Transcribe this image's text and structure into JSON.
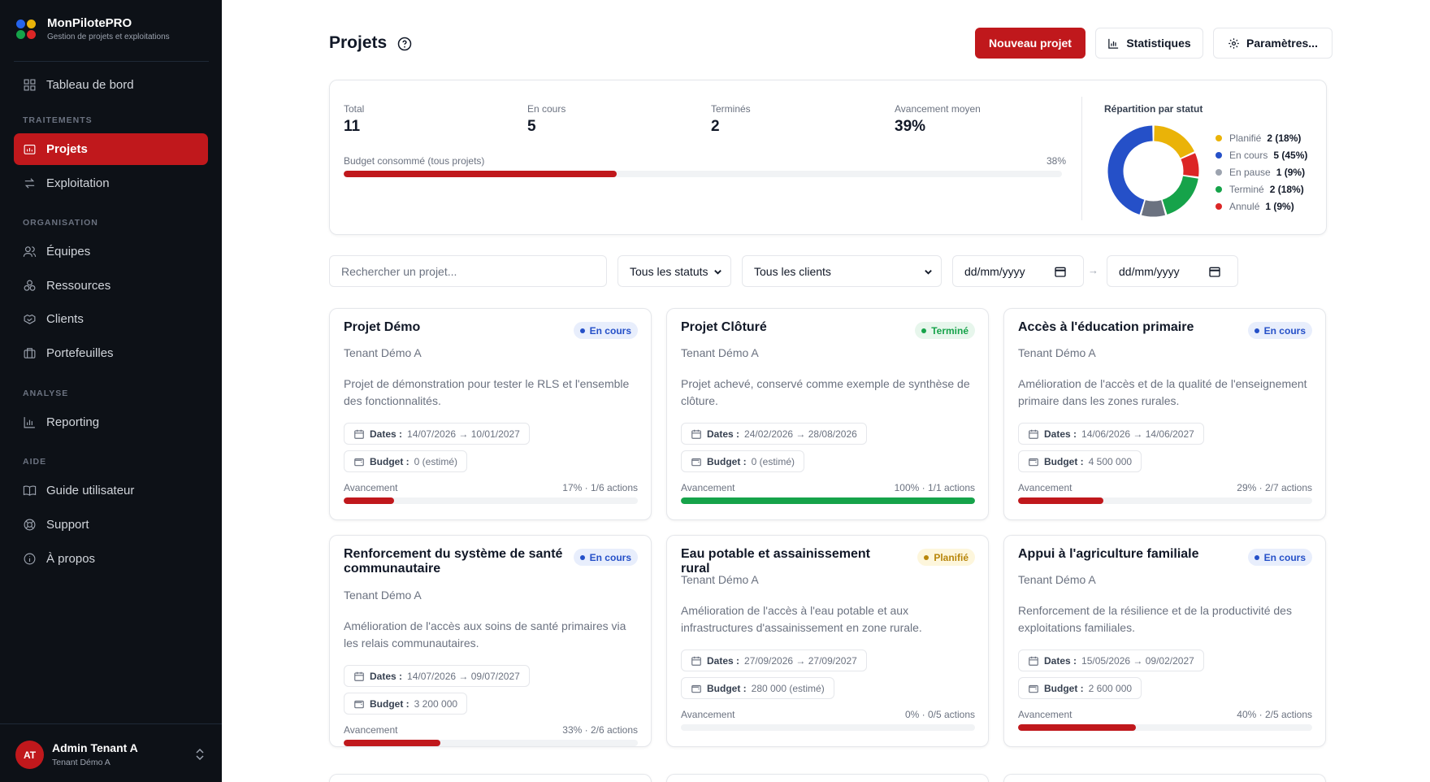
{
  "app": {
    "name": "MonPilotePRO",
    "subtitle": "Gestion de projets et exploitations",
    "logo_colors": [
      "#2563eb",
      "#eab308",
      "#16a34a",
      "#dc2626"
    ]
  },
  "sidebar": {
    "dashboard": "Tableau de bord",
    "sections": {
      "traitements": "TRAITEMENTS",
      "organisation": "ORGANISATION",
      "analyse": "ANALYSE",
      "aide": "AIDE"
    },
    "items": {
      "projets": "Projets",
      "exploitation": "Exploitation",
      "equipes": "Équipes",
      "ressources": "Ressources",
      "clients": "Clients",
      "portefeuilles": "Portefeuilles",
      "reporting": "Reporting",
      "guide": "Guide utilisateur",
      "support": "Support",
      "apropos": "À propos"
    },
    "user": {
      "initials": "AT",
      "name": "Admin Tenant A",
      "tenant": "Tenant Démo A"
    }
  },
  "header": {
    "title": "Projets",
    "buttons": {
      "new": "Nouveau projet",
      "stats": "Statistiques",
      "settings": "Paramètres..."
    }
  },
  "stats": {
    "total_label": "Total",
    "total_value": "11",
    "encours_label": "En cours",
    "encours_value": "5",
    "termines_label": "Terminés",
    "termines_value": "2",
    "avancement_label": "Avancement moyen",
    "avancement_value": "39%",
    "budget_label": "Budget consommé (tous projets)",
    "budget_pct": "38%",
    "budget_fraction": 0.38,
    "repartition_title": "Répartition par statut",
    "repartition": [
      {
        "label": "Planifié",
        "value": "2 (18%)",
        "count": 2,
        "color": "#eab308"
      },
      {
        "label": "En cours",
        "value": "5 (45%)",
        "count": 5,
        "color": "#2550c8"
      },
      {
        "label": "En pause",
        "value": "1 (9%)",
        "count": 1,
        "color": "#9ca3af"
      },
      {
        "label": "Terminé",
        "value": "2 (18%)",
        "count": 2,
        "color": "#16a34a"
      },
      {
        "label": "Annulé",
        "value": "1 (9%)",
        "count": 1,
        "color": "#dc2626"
      }
    ],
    "donut_order": [
      {
        "count": 2,
        "color": "#eab308"
      },
      {
        "count": 1,
        "color": "#dc2626"
      },
      {
        "count": 2,
        "color": "#16a34a"
      },
      {
        "count": 1,
        "color": "#6b7280"
      },
      {
        "count": 5,
        "color": "#2550c8"
      }
    ]
  },
  "filters": {
    "search_placeholder": "Rechercher un projet...",
    "status_value": "Tous les statuts",
    "client_value": "Tous les clients",
    "date_from": "dd/mm/yyyy",
    "date_to": "dd/mm/yyyy",
    "separator": "→"
  },
  "colors": {
    "accent": "#c0181c",
    "encours_badge_bg": "#e8eefc",
    "encours_badge_fg": "#2550c8",
    "termine_badge_bg": "#e7f6ec",
    "termine_badge_fg": "#16a34a",
    "planifie_badge_bg": "#fdf6dc",
    "planifie_badge_fg": "#b8860b",
    "progress_red": "#c0181c",
    "progress_green": "#16a34a"
  },
  "projects": [
    {
      "title": "Projet Démo",
      "status": "En cours",
      "status_kind": "encours",
      "tenant": "Tenant Démo A",
      "description": "Projet de démonstration pour tester le RLS et l'ensemble des fonctionnalités.",
      "dates_label": "Dates :",
      "dates": "14/07/2026 → 10/01/2027",
      "budget_label": "Budget :",
      "budget": "0 (estimé)",
      "progress_label": "Avancement",
      "progress_meta": "17% · 1/6 actions",
      "progress": 0.17
    },
    {
      "title": "Projet Clôturé",
      "status": "Terminé",
      "status_kind": "termine",
      "tenant": "Tenant Démo A",
      "description": "Projet achevé, conservé comme exemple de synthèse de clôture.",
      "dates_label": "Dates :",
      "dates": "24/02/2026 → 28/08/2026",
      "budget_label": "Budget :",
      "budget": "0 (estimé)",
      "progress_label": "Avancement",
      "progress_meta": "100% · 1/1 actions",
      "progress": 1.0
    },
    {
      "title": "Accès à l'éducation primaire",
      "status": "En cours",
      "status_kind": "encours",
      "tenant": "Tenant Démo A",
      "description": "Amélioration de l'accès et de la qualité de l'enseignement primaire dans les zones rurales.",
      "dates_label": "Dates :",
      "dates": "14/06/2026 → 14/06/2027",
      "budget_label": "Budget :",
      "budget": "4 500 000",
      "progress_label": "Avancement",
      "progress_meta": "29% · 2/7 actions",
      "progress": 0.29
    },
    {
      "title": "Renforcement du système de santé communautaire",
      "status": "En cours",
      "status_kind": "encours",
      "tenant": "Tenant Démo A",
      "description": "Amélioration de l'accès aux soins de santé primaires via les relais communautaires.",
      "dates_label": "Dates :",
      "dates": "14/07/2026 → 09/07/2027",
      "budget_label": "Budget :",
      "budget": "3 200 000",
      "progress_label": "Avancement",
      "progress_meta": "33% · 2/6 actions",
      "progress": 0.33
    },
    {
      "title": "Eau potable et assainissement rural",
      "status": "Planifié",
      "status_kind": "planifie",
      "tenant": "Tenant Démo A",
      "description": "Amélioration de l'accès à l'eau potable et aux infrastructures d'assainissement en zone rurale.",
      "dates_label": "Dates :",
      "dates": "27/09/2026 → 27/09/2027",
      "budget_label": "Budget :",
      "budget": "280 000 (estimé)",
      "progress_label": "Avancement",
      "progress_meta": "0% · 0/5 actions",
      "progress": 0.0
    },
    {
      "title": "Appui à l'agriculture familiale",
      "status": "En cours",
      "status_kind": "encours",
      "tenant": "Tenant Démo A",
      "description": "Renforcement de la résilience et de la productivité des exploitations familiales.",
      "dates_label": "Dates :",
      "dates": "15/05/2026 → 09/02/2027",
      "budget_label": "Budget :",
      "budget": "2 600 000",
      "progress_label": "Avancement",
      "progress_meta": "40% · 2/5 actions",
      "progress": 0.4
    }
  ]
}
